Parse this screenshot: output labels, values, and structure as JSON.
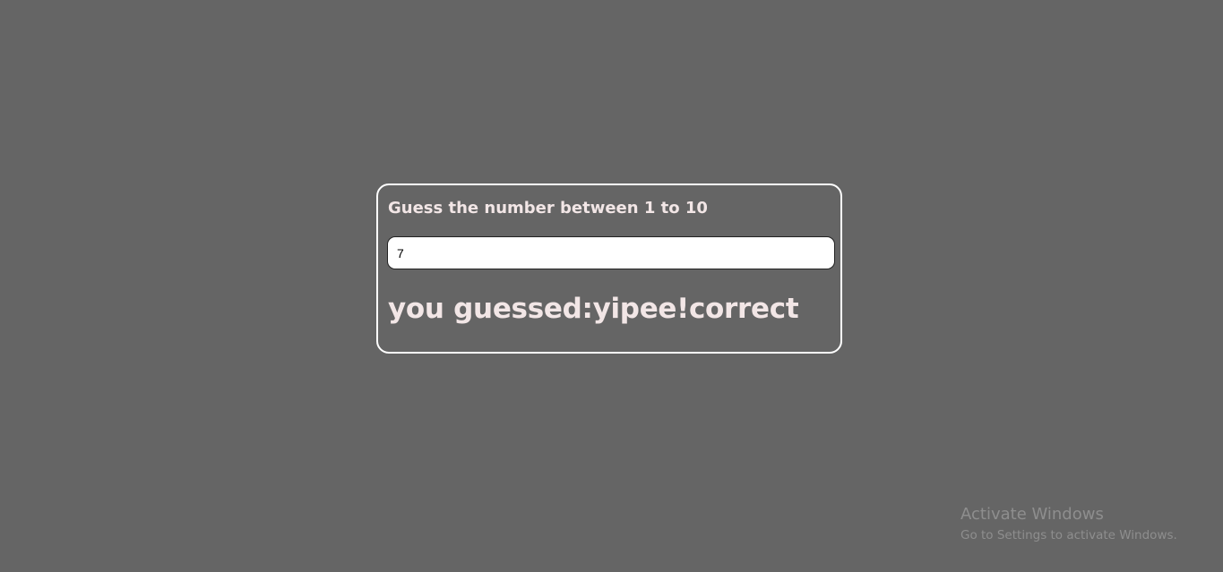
{
  "game": {
    "prompt": "Guess the number between 1 to 10",
    "input_value": "7",
    "result": "you guessed:yipee!correct"
  },
  "watermark": {
    "title": "Activate Windows",
    "subtitle": "Go to Settings to activate Windows."
  },
  "colors": {
    "background": "#656565",
    "text": "#f2e6e6",
    "card_border": "#ffffff"
  }
}
